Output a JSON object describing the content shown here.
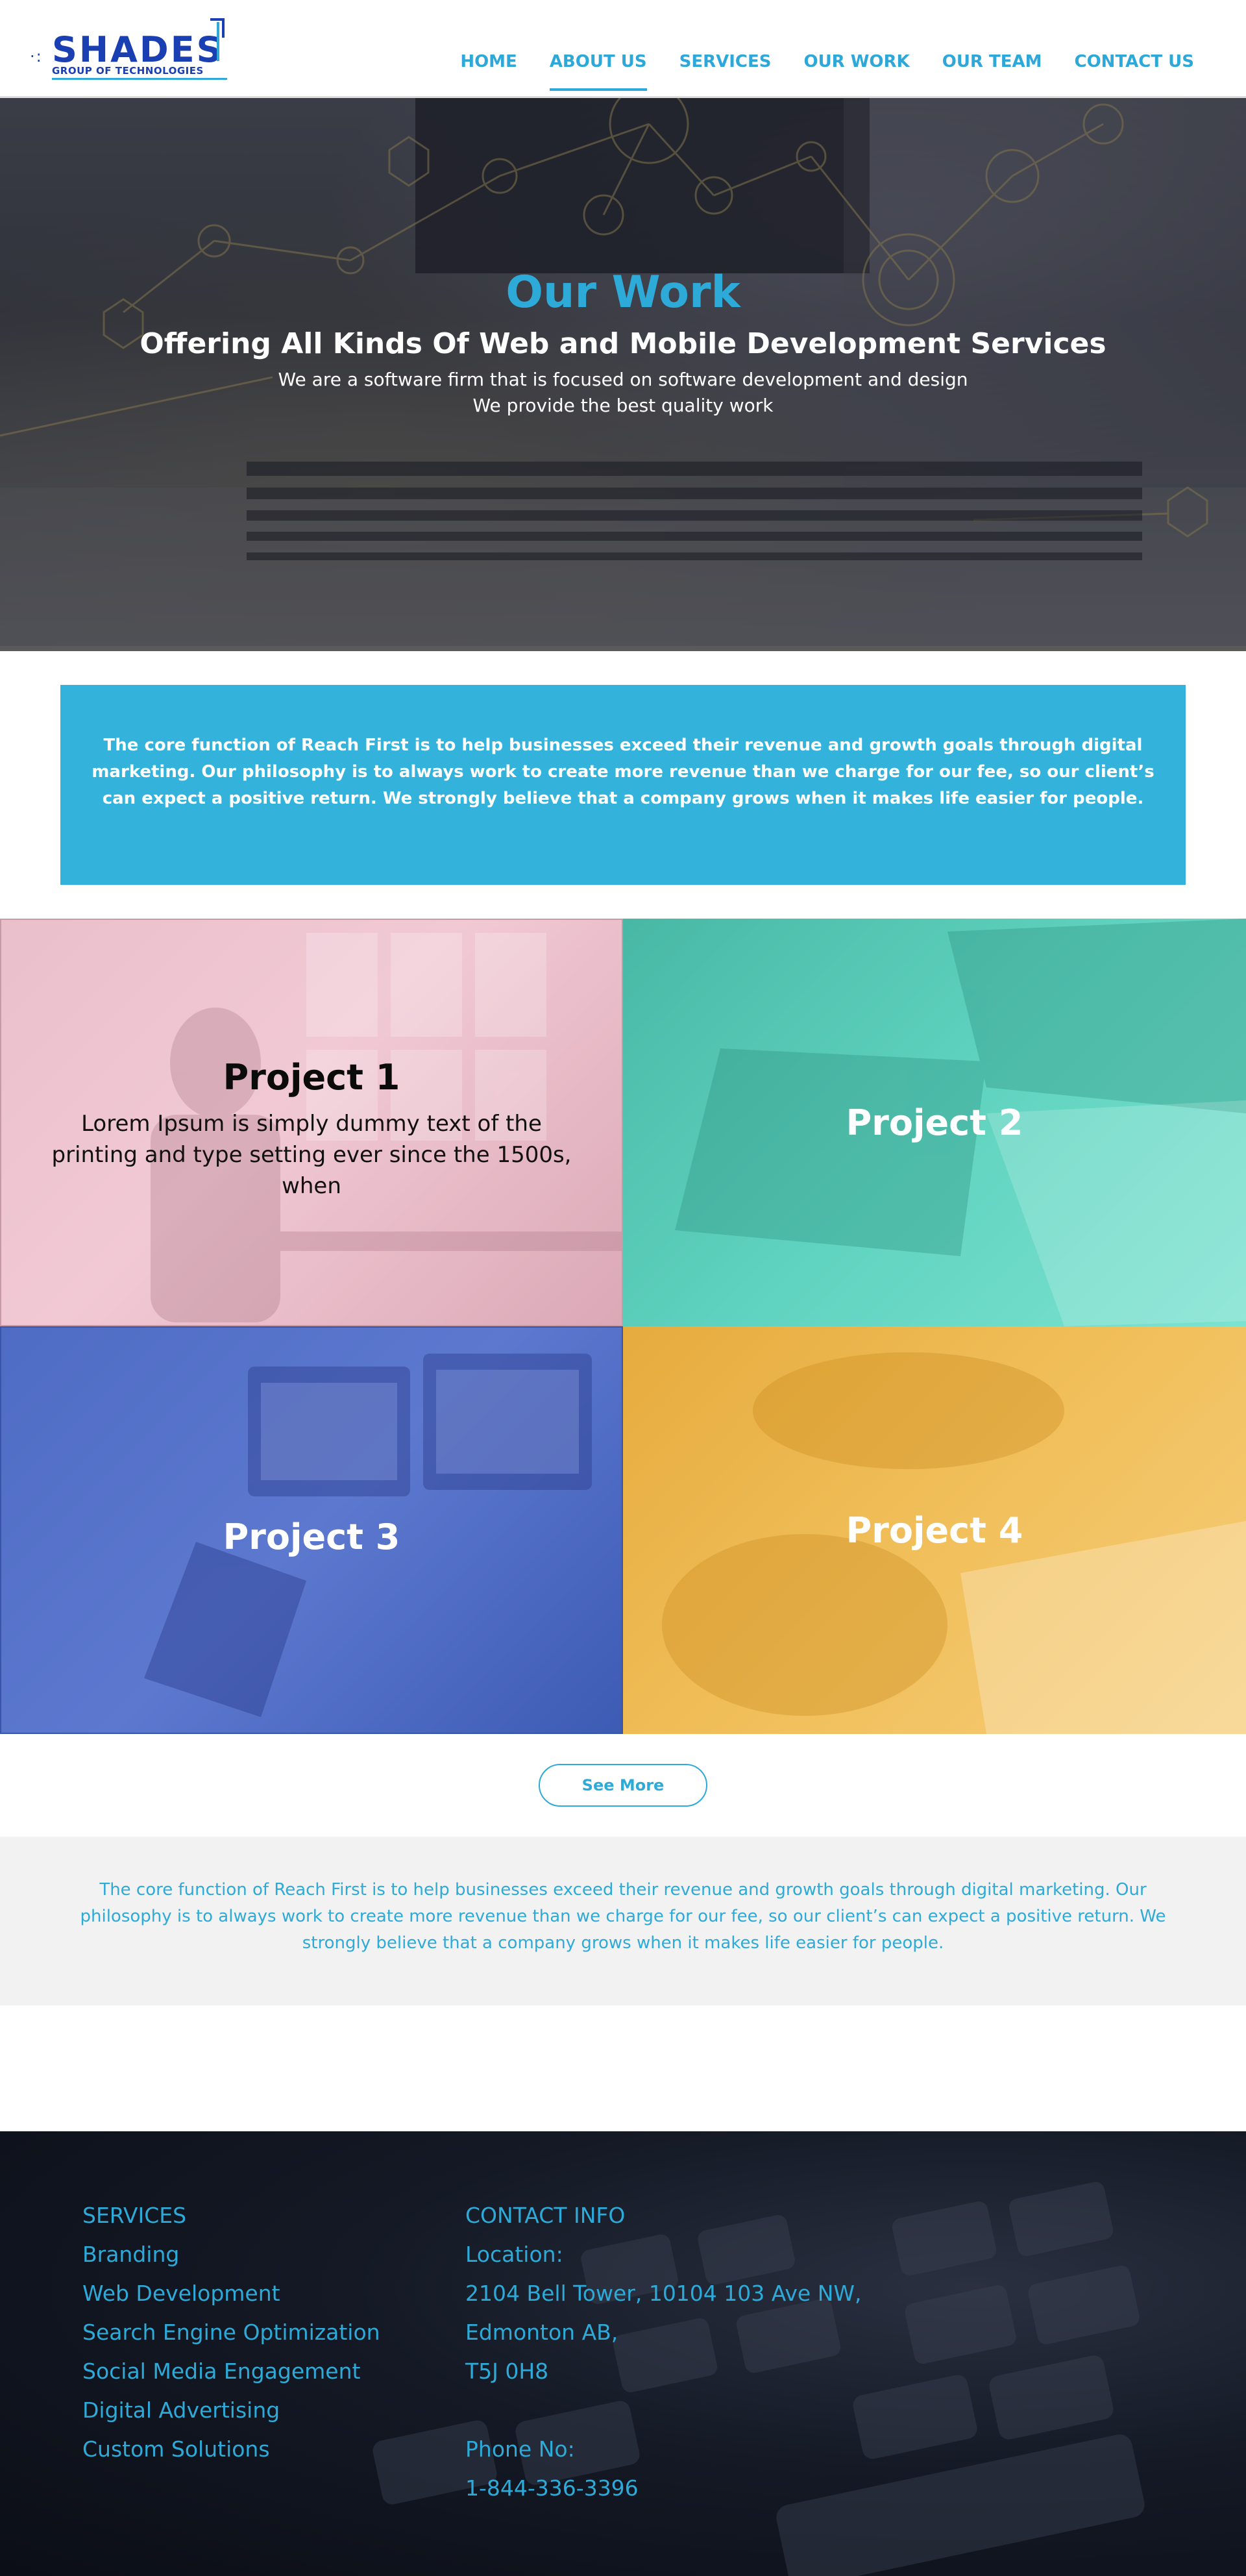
{
  "brand": {
    "name": "SHADES",
    "tagline": "GROUP OF TECHNOLOGIES"
  },
  "nav": {
    "items": [
      {
        "label": "HOME"
      },
      {
        "label": "ABOUT US"
      },
      {
        "label": "SERVICES"
      },
      {
        "label": "OUR WORK"
      },
      {
        "label": "OUR TEAM"
      },
      {
        "label": "CONTACT US"
      }
    ],
    "active_index": 1
  },
  "hero": {
    "title": "Our Work",
    "subtitle": "Offering All Kinds Of Web and Mobile Development Services",
    "line1": "We are a software firm that is focused on software development and design",
    "line2": "We provide the best quality work"
  },
  "intro": {
    "text": "The core function of Reach First is to help businesses exceed their revenue and growth goals through digital marketing. Our philosophy is to always work to create more revenue than we charge for our fee, so our client’s can expect a positive return. We strongly believe that a company grows when it makes life easier for people."
  },
  "projects": [
    {
      "title": "Project 1",
      "description": "Lorem Ipsum is simply dummy text of the printing and type setting  ever since the 1500s, when"
    },
    {
      "title": "Project 2"
    },
    {
      "title": "Project 3"
    },
    {
      "title": "Project 4"
    }
  ],
  "see_more": {
    "label": "See More"
  },
  "about_band": {
    "text": "The core function of Reach First is to help businesses exceed their revenue and growth goals through digital marketing. Our philosophy is to always work to create more revenue than we charge for our fee, so our client’s can expect a positive return. We strongly believe that a company grows when it makes life easier for people."
  },
  "footer": {
    "services": {
      "heading": "SERVICES",
      "items": [
        "Branding",
        "Web Development",
        "Search Engine Optimization",
        "Social Media Engagement",
        "Digital Advertising",
        "Custom Solutions"
      ]
    },
    "contact": {
      "heading": "CONTACT INFO",
      "location_label": "Location:",
      "address_line1": "2104 Bell Tower, 10104 103 Ave NW,",
      "address_line2": "Edmonton AB,",
      "address_line3": "T5J 0H8",
      "phone_label": "Phone No:",
      "phone": "1-844-336-3396"
    }
  },
  "colors": {
    "accent": "#2eaad9",
    "brand_blue": "#1a3fb3",
    "intro_bg": "#33b3dc",
    "project1_tint": "#f1c9d4",
    "project2_tint": "#5fd3bf",
    "project3_tint": "#5c78cf",
    "project4_tint": "#f1bf5a",
    "footer_bg": "#141925"
  }
}
